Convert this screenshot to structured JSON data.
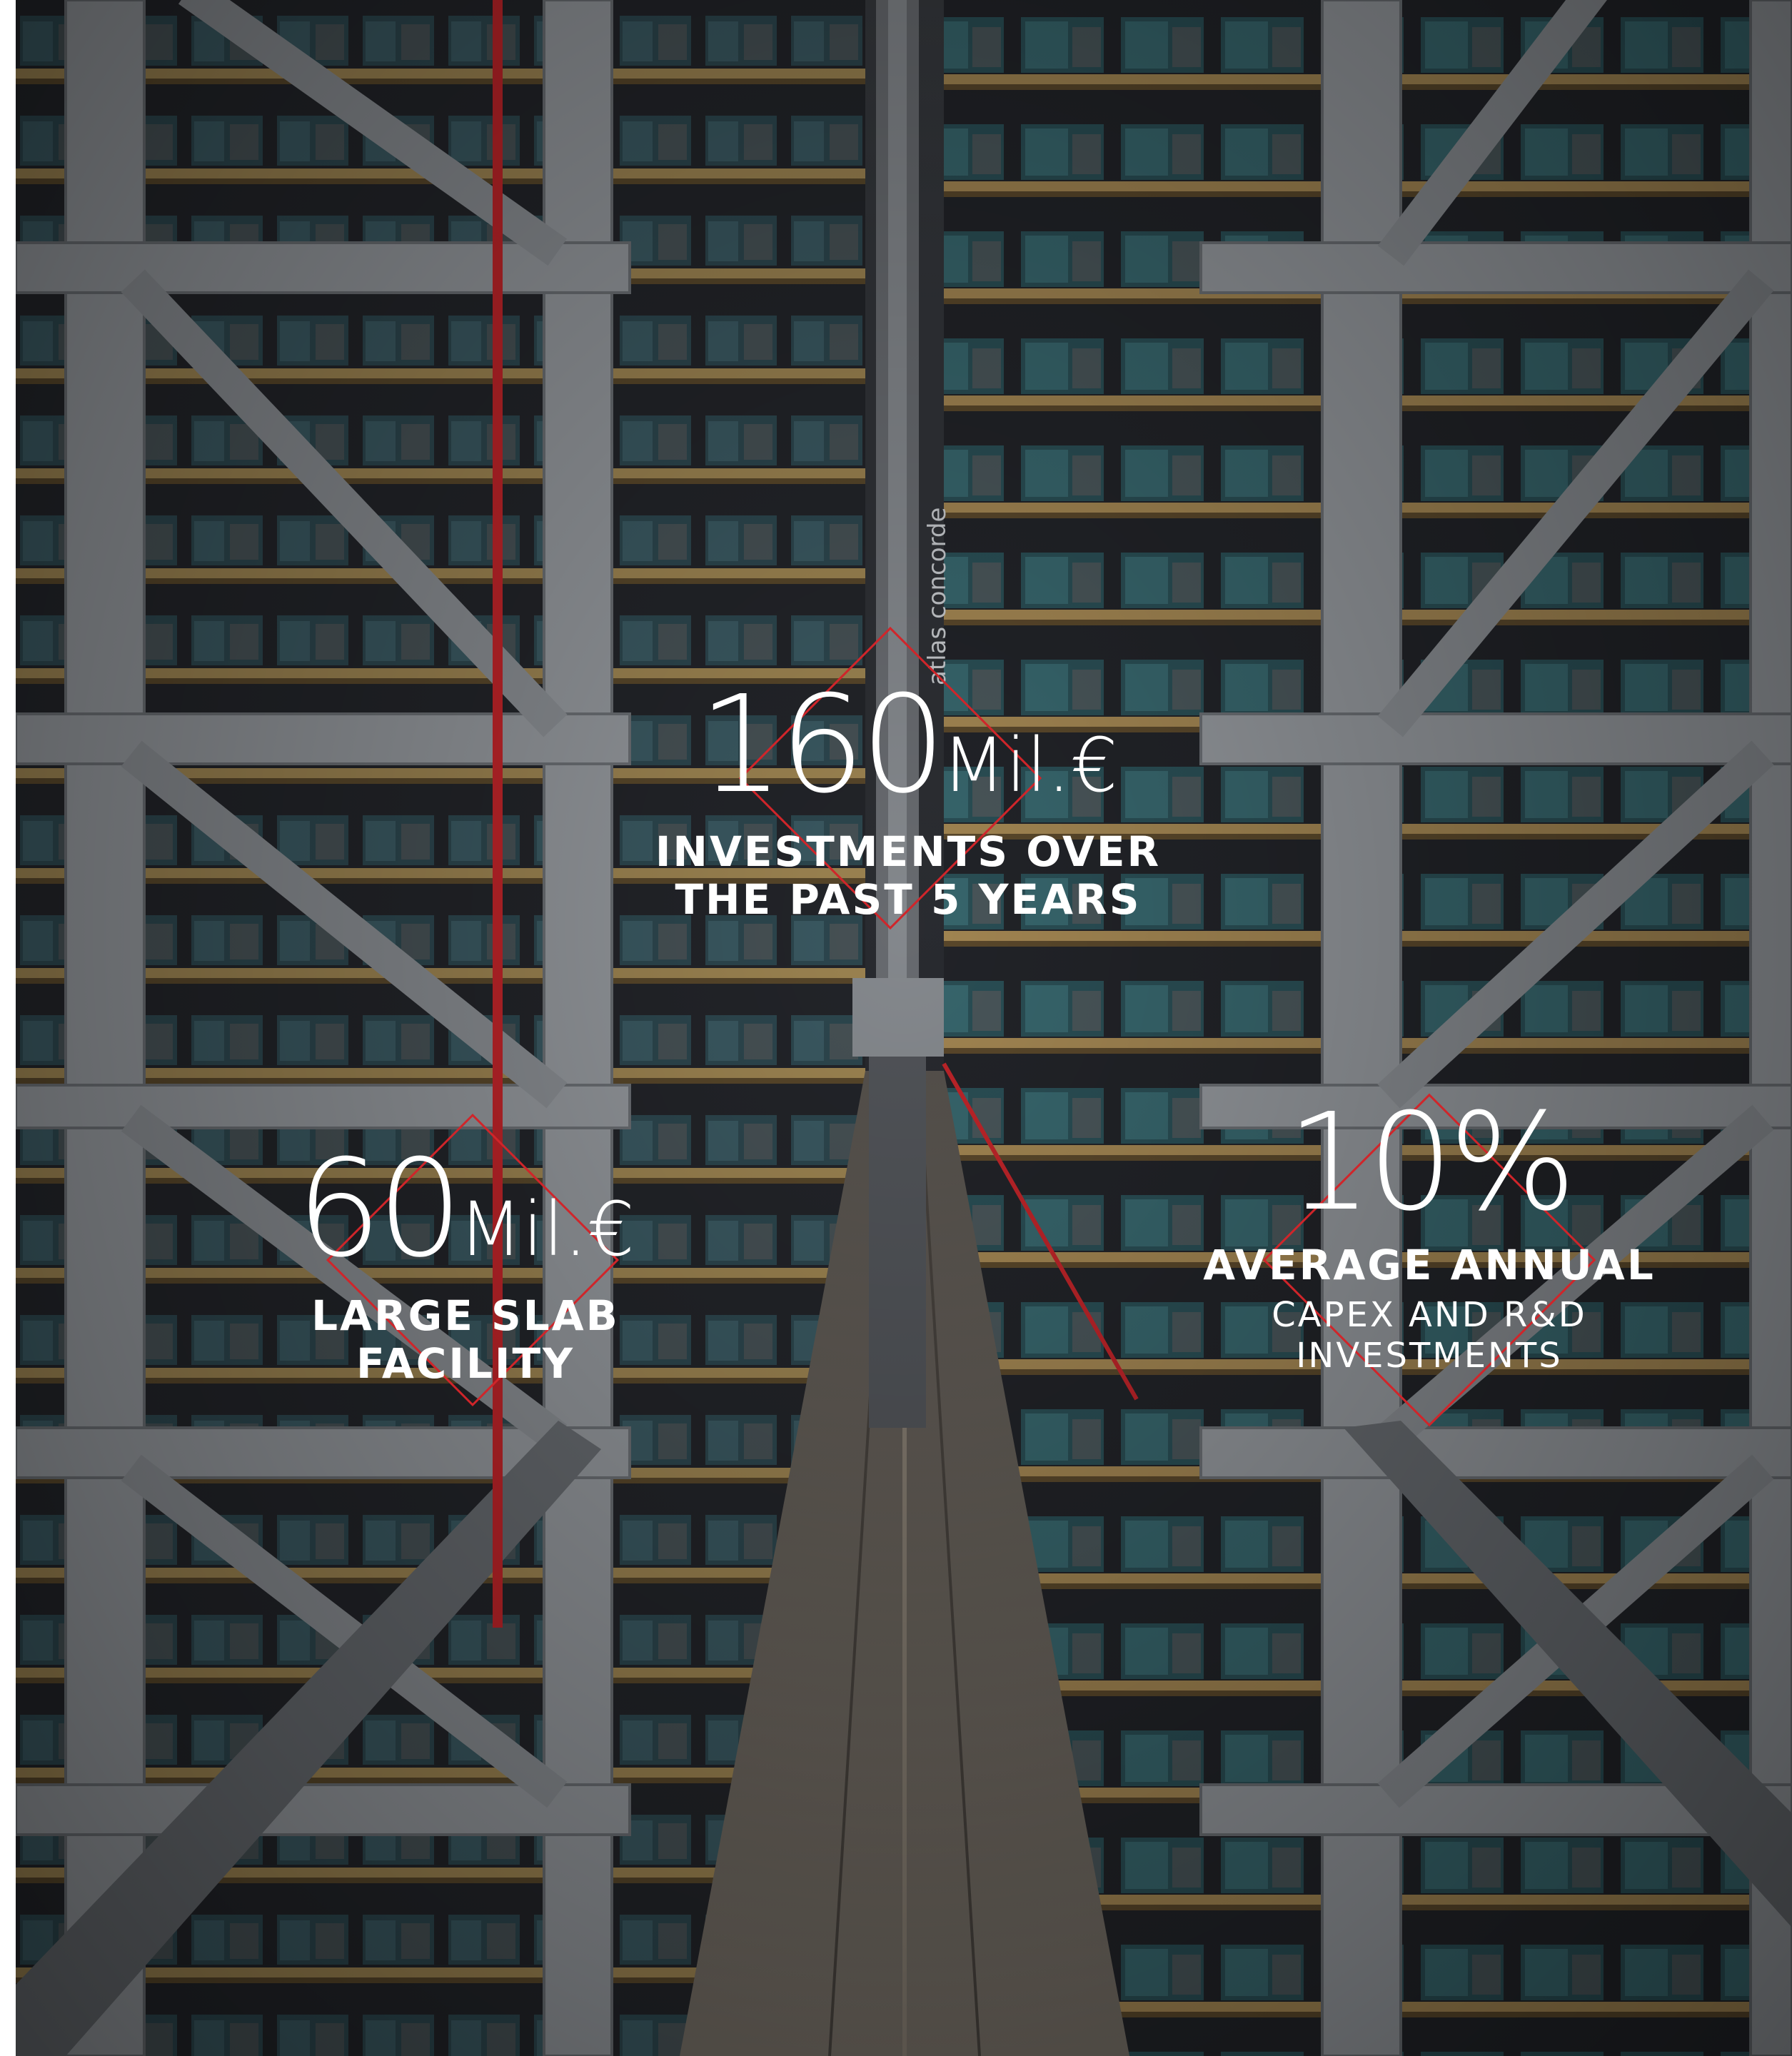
{
  "colors": {
    "accent": "#d0252a",
    "text": "#ffffff",
    "steel": "#9a9ea3",
    "shadow": "#1b1c20"
  },
  "background": {
    "subject": "warehouse-racking-aisle",
    "rack_label": "atlas concorde"
  },
  "stats": [
    {
      "value": "160",
      "unit": "Mil.€",
      "caption_bold": [
        "INVESTMENTS OVER",
        "THE PAST 5 YEARS"
      ],
      "caption_light": []
    },
    {
      "value": "60",
      "unit": "Mil.€",
      "caption_bold": [
        "LARGE SLAB",
        "FACILITY"
      ],
      "caption_light": []
    },
    {
      "value": "10%",
      "unit": "",
      "caption_bold": [
        "AVERAGE ANNUAL"
      ],
      "caption_light": [
        "CAPEX AND R&D",
        "INVESTMENTS"
      ]
    }
  ]
}
